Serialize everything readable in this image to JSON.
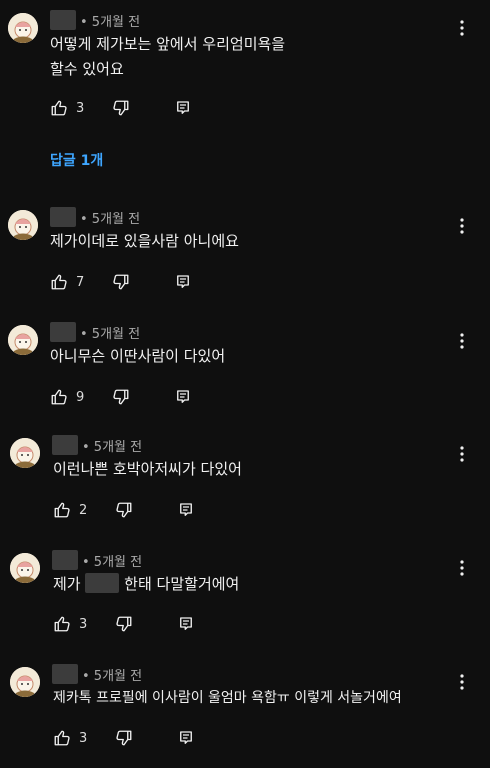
{
  "comments": [
    {
      "time": "• 5개월 전",
      "line1": "어떻게 제가보는 앞에서 우리엄미욕을",
      "line2": "할수 있어요",
      "likes": "3"
    },
    {
      "time": "• 5개월 전",
      "line1": "제가이데로 있을사람 아니에요",
      "likes": "7"
    },
    {
      "time": "• 5개월 전",
      "line1": "아니무슨 이딴사람이 다있어",
      "likes": "9"
    },
    {
      "time": "• 5개월 전",
      "line1": "이런나쁜 호박아저씨가 다있어",
      "likes": "2"
    },
    {
      "time": "• 5개월 전",
      "line1a": "제가",
      "line1b": "한태 다말할거에여",
      "likes": "3"
    },
    {
      "time": "• 5개월 전",
      "line1": "제카톡 프로필에 이사람이 울엄마 욕함ㅠ 이렇게 서놀거에여",
      "likes": "3"
    }
  ],
  "replies_link": "답글 1개",
  "colors": {
    "background": "#0f0f0f",
    "text": "#f1f1f1",
    "meta": "#aaaaaa",
    "link": "#3ea6ff"
  },
  "icons": {
    "like": "thumbs-up-icon",
    "dislike": "thumbs-down-icon",
    "reply": "reply-icon",
    "more": "more-vert-icon"
  }
}
